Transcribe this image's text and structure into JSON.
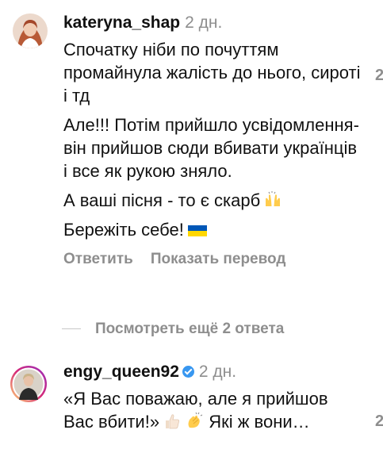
{
  "comments": [
    {
      "username": "kateryna_shap",
      "time": "2 дн.",
      "paragraphs": [
        "Спочатку ніби по почуттям промайнула жалість до нього, сироті і тд",
        "Але!!! Потім прийшло усвідомлення- він прийшов сюди вбивати українців і все як рукою зняло.",
        "А ваші пісня - то є скарб",
        "Бережіть себе!"
      ],
      "emoji": [
        "raising-hands",
        "ukraine-flag"
      ],
      "reply_label": "Ответить",
      "translate_label": "Показать перевод",
      "like_count": "2"
    },
    {
      "username": "engy_queen92",
      "time": "2 дн.",
      "verified": true,
      "text_start": "«Я Вас поважаю, але я прийшов Вас вбити!»",
      "text_end": "Які ж вони…",
      "emoji": [
        "thumbs-up",
        "clapping-hands"
      ],
      "like_count": "2"
    }
  ],
  "more_replies_label": "Посмотреть ещё 2 ответа",
  "colors": {
    "text": "#111111",
    "secondary": "#8e8e8e",
    "verified": "#3897f0",
    "flag_blue": "#0057b7",
    "flag_yellow": "#ffd700"
  }
}
